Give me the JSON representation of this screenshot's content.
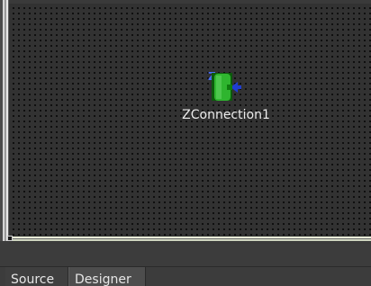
{
  "designer": {
    "components": [
      {
        "name": "ZConnection1",
        "icon": "zconnection-icon"
      }
    ]
  },
  "tabs": [
    {
      "label": "Source",
      "active": false
    },
    {
      "label": "Designer",
      "active": true
    }
  ]
}
